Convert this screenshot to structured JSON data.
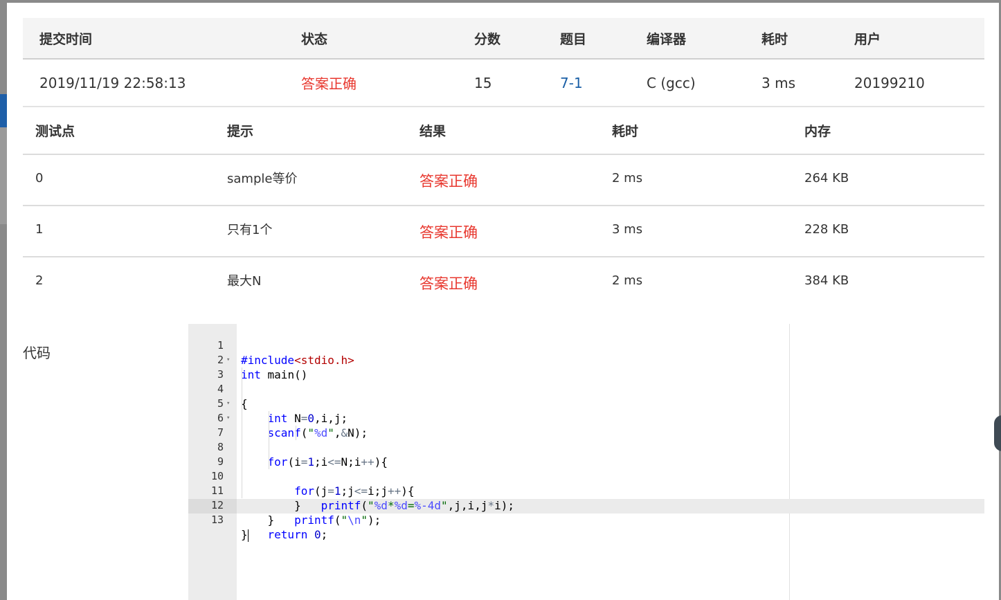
{
  "submission": {
    "headers": {
      "time": "提交时间",
      "status": "状态",
      "score": "分数",
      "problem": "题目",
      "compiler": "编译器",
      "elapsed": "耗时",
      "user": "用户"
    },
    "row": {
      "time": "2019/11/19 22:58:13",
      "status": "答案正确",
      "score": "15",
      "problem": "7-1",
      "compiler": "C (gcc)",
      "elapsed": "3 ms",
      "user": "20199210"
    }
  },
  "cases": {
    "headers": {
      "id": "测试点",
      "hint": "提示",
      "result": "结果",
      "time": "耗时",
      "memory": "内存"
    },
    "rows": [
      {
        "id": "0",
        "hint": "sample等价",
        "result": "答案正确",
        "time": "2 ms",
        "memory": "264 KB"
      },
      {
        "id": "1",
        "hint": "只有1个",
        "result": "答案正确",
        "time": "3 ms",
        "memory": "228 KB"
      },
      {
        "id": "2",
        "hint": "最大N",
        "result": "答案正确",
        "time": "2 ms",
        "memory": "384 KB"
      }
    ]
  },
  "code_section": {
    "label": "代码",
    "line_numbers": [
      "1",
      "2",
      "3",
      "4",
      "5",
      "6",
      "7",
      "8",
      "9",
      "10",
      "11",
      "12",
      "13"
    ],
    "lines": [
      "#include<stdio.h>",
      "int main()",
      "{",
      "    int N=0,i,j;",
      "    scanf(\"%d\",&N);",
      "    for(i=1;i<=N;i++){",
      "        for(j=1;j<=i;j++){",
      "            printf(\"%d*%d=%-4d\",j,i,j*i);",
      "        }",
      "        printf(\"\\n\");",
      "    }",
      "    return 0;",
      "}"
    ],
    "fold_marker": "▾"
  },
  "colors": {
    "accepted": "#e8382f",
    "link": "#1a5fa6",
    "keyword": "#0000ff",
    "string": "#036a07",
    "preprocessor": "#b30000"
  }
}
